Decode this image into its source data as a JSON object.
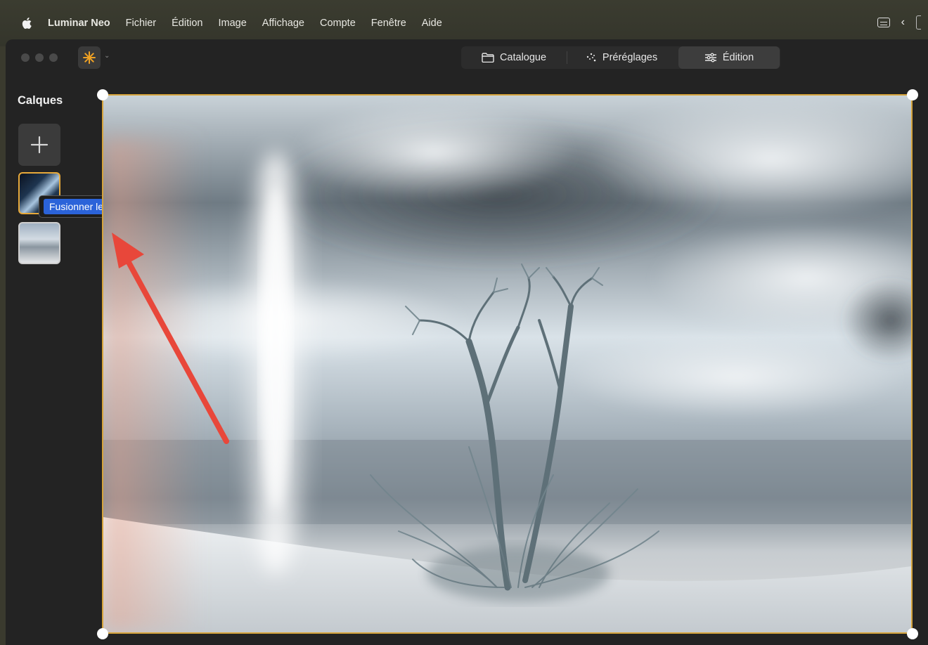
{
  "menubar": {
    "app_name": "Luminar Neo",
    "items": [
      "Fichier",
      "Édition",
      "Image",
      "Affichage",
      "Compte",
      "Fenêtre",
      "Aide"
    ]
  },
  "toolbar": {
    "tabs": [
      {
        "label": "Catalogue",
        "icon": "folder-icon"
      },
      {
        "label": "Préréglages",
        "icon": "sparkle-icon"
      },
      {
        "label": "Édition",
        "icon": "sliders-icon"
      }
    ],
    "active_tab": "Édition",
    "accent": "#f0a224"
  },
  "layers": {
    "title": "Calques",
    "add_icon": "plus-icon",
    "tooltip": "Fusionner les calques",
    "selected_border": "#e7a93a"
  },
  "canvas": {
    "frame_color": "#d6a43c",
    "annotation_arrow_color": "#e8473a"
  }
}
